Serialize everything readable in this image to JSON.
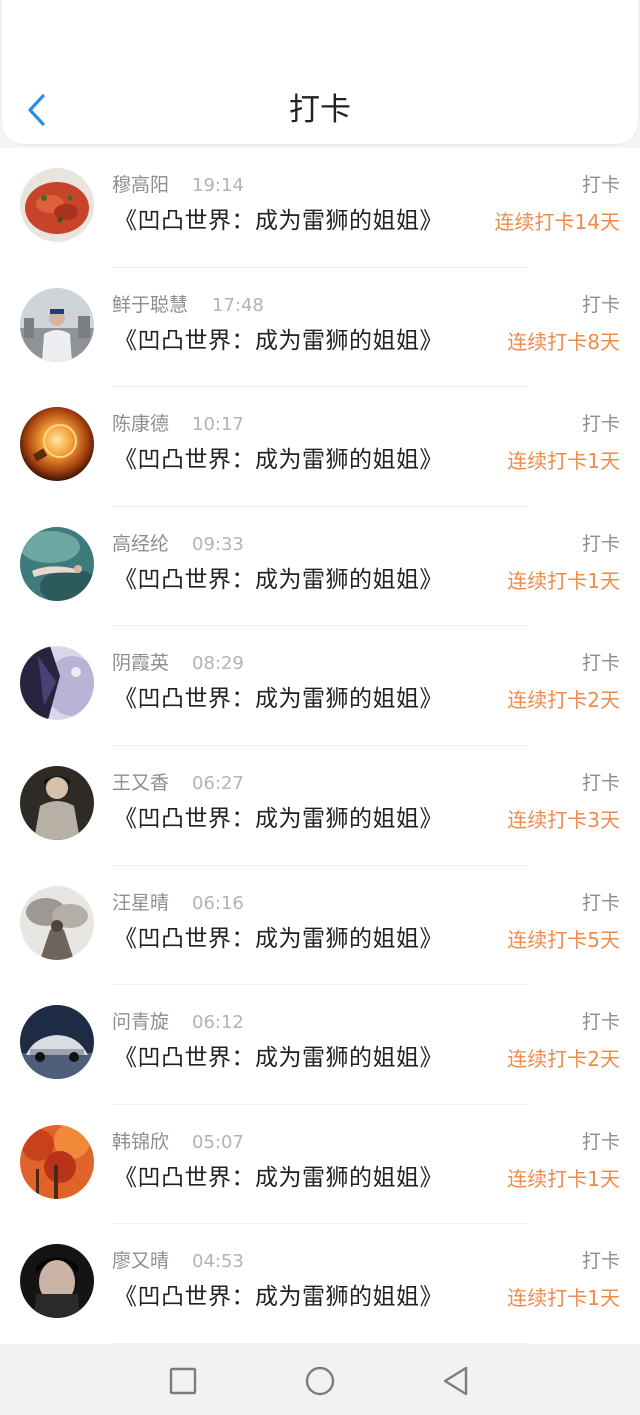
{
  "header": {
    "title": "打卡",
    "back_icon": "chevron-left-icon"
  },
  "colors": {
    "accent_orange": "#f08a4b",
    "back_blue": "#2f8de4"
  },
  "checkins": [
    {
      "name": "穆高阳",
      "time": "19:14",
      "book": "《凹凸世界：成为雷狮的姐姐》",
      "action": "打卡",
      "streak": "连续打卡14天"
    },
    {
      "name": "鲜于聪慧",
      "time": "17:48",
      "book": "《凹凸世界：成为雷狮的姐姐》",
      "action": "打卡",
      "streak": "连续打卡8天"
    },
    {
      "name": "陈康德",
      "time": "10:17",
      "book": "《凹凸世界：成为雷狮的姐姐》",
      "action": "打卡",
      "streak": "连续打卡1天"
    },
    {
      "name": "高经纶",
      "time": "09:33",
      "book": "《凹凸世界：成为雷狮的姐姐》",
      "action": "打卡",
      "streak": "连续打卡1天"
    },
    {
      "name": "阴霞英",
      "time": "08:29",
      "book": "《凹凸世界：成为雷狮的姐姐》",
      "action": "打卡",
      "streak": "连续打卡2天"
    },
    {
      "name": "王又香",
      "time": "06:27",
      "book": "《凹凸世界：成为雷狮的姐姐》",
      "action": "打卡",
      "streak": "连续打卡3天"
    },
    {
      "name": "汪星晴",
      "time": "06:16",
      "book": "《凹凸世界：成为雷狮的姐姐》",
      "action": "打卡",
      "streak": "连续打卡5天"
    },
    {
      "name": "问青旋",
      "time": "06:12",
      "book": "《凹凸世界：成为雷狮的姐姐》",
      "action": "打卡",
      "streak": "连续打卡2天"
    },
    {
      "name": "韩锦欣",
      "time": "05:07",
      "book": "《凹凸世界：成为雷狮的姐姐》",
      "action": "打卡",
      "streak": "连续打卡1天"
    },
    {
      "name": "廖又晴",
      "time": "04:53",
      "book": "《凹凸世界：成为雷狮的姐姐》",
      "action": "打卡",
      "streak": "连续打卡1天"
    }
  ],
  "navbar": {
    "icons": [
      "square-recents-icon",
      "circle-home-icon",
      "triangle-back-icon"
    ]
  }
}
